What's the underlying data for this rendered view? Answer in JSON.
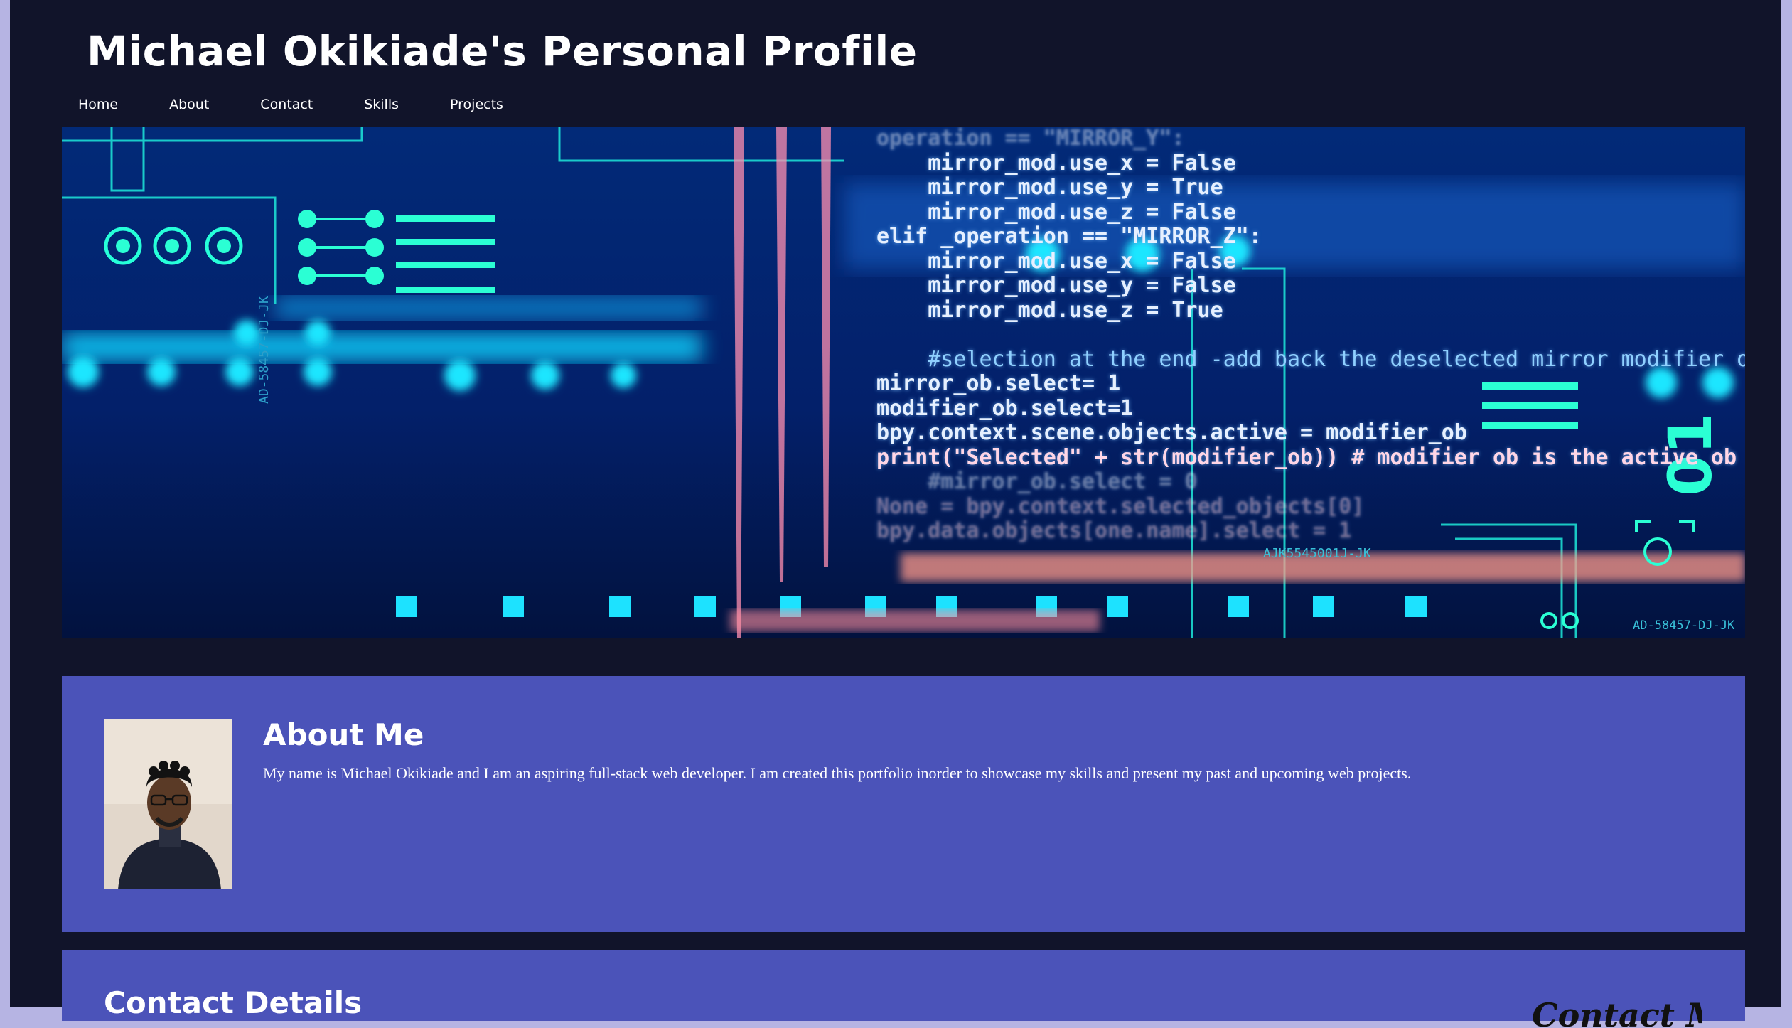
{
  "header": {
    "title": "Michael Okikiade's Personal Profile"
  },
  "nav": {
    "items": [
      "Home",
      "About",
      "Contact",
      "Skills",
      "Projects"
    ]
  },
  "hero": {
    "code_lines": [
      "operation == \"MIRROR_Y\":",
      "    mirror_mod.use_x = False",
      "    mirror_mod.use_y = True",
      "    mirror_mod.use_z = False",
      "elif _operation == \"MIRROR_Z\":",
      "    mirror_mod.use_x = False",
      "    mirror_mod.use_y = False",
      "    mirror_mod.use_z = True",
      "",
      "    #selection at the end -add back the deselected mirror modifier object",
      "mirror_ob.select= 1",
      "modifier_ob.select=1",
      "bpy.context.scene.objects.active = modifier_ob",
      "print(\"Selected\" + str(modifier_ob)) # modifier ob is the active ob",
      "    #mirror_ob.select = 0",
      "None = bpy.context.selected_objects[0]",
      "bpy.data.objects[one.name].select = 1"
    ],
    "serials": [
      "AJK5545001J-JK",
      "AD-58457-DJ-JK",
      "AD-58457-DJ-JK"
    ],
    "digits": "01"
  },
  "about": {
    "title": "About Me",
    "text": "My name is Michael Okikiade and I am an aspiring full-stack web developer. I am created this portfolio inorder to showcase my skills and present my past and upcoming web projects."
  },
  "contact": {
    "title": "Contact Details",
    "signature": "Contact Me"
  },
  "colors": {
    "page_bg": "#11142a",
    "card_bg": "#4b53b9",
    "outer_bg": "#b6b4e3",
    "text": "#ffffff"
  }
}
